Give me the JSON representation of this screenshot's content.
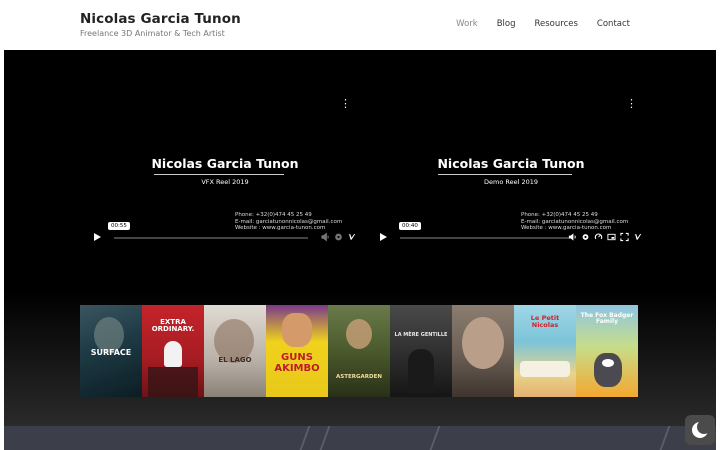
{
  "brand": {
    "title": "Nicolas Garcia Tunon",
    "subtitle": "Freelance 3D Animator & Tech Artist"
  },
  "nav": [
    {
      "label": "Work",
      "active": true
    },
    {
      "label": "Blog",
      "active": false
    },
    {
      "label": "Resources",
      "active": false
    },
    {
      "label": "Contact",
      "active": false
    }
  ],
  "videos": [
    {
      "title": "Nicolas Garcia Tunon",
      "subtitle": "VFX Reel 2019",
      "phone": "Phone: +32(0)474 45 25 49",
      "email": "E-mail: garciatunonnicolas@gmail.com",
      "website": "Website : www.garcia-tunon.com",
      "time": "00:55"
    },
    {
      "title": "Nicolas Garcia Tunon",
      "subtitle": "Demo Reel 2019",
      "phone": "Phone: +32(0)474 45 25 49",
      "email": "E-mail: garciatunonnicolas@gmail.com",
      "website": "Website : www.garcia-tunon.com",
      "time": "00:40"
    }
  ],
  "posters": [
    {
      "title": "SURFACE",
      "bg": "#1d3a44"
    },
    {
      "title": "EXTRA ORDINARY.",
      "bg": "#b21d24"
    },
    {
      "title": "EL LAGO",
      "bg": "#c9c4bd"
    },
    {
      "title": "GUNS AKIMBO",
      "bg": "#e8c81a"
    },
    {
      "title": "ASTERGARDEN",
      "bg": "#4a5a2c"
    },
    {
      "title": "LA MÈRE GENTILLE",
      "bg": "#2b2b2b"
    },
    {
      "title": "",
      "bg": "#6a5e53"
    },
    {
      "title": "Le Petit Nicolas",
      "bg": "#7cc4d8"
    },
    {
      "title": "The Fox Badger Family",
      "bg": "#f3a830"
    }
  ],
  "icons": {
    "menu": "kebab-menu-icon",
    "play": "play-icon",
    "darkmode": "moon-icon"
  },
  "colors": {
    "brand_text": "#222222",
    "nav_active": "#888888",
    "hero_bg": "#000000",
    "darkmode_bg": "#4b4b4b"
  }
}
